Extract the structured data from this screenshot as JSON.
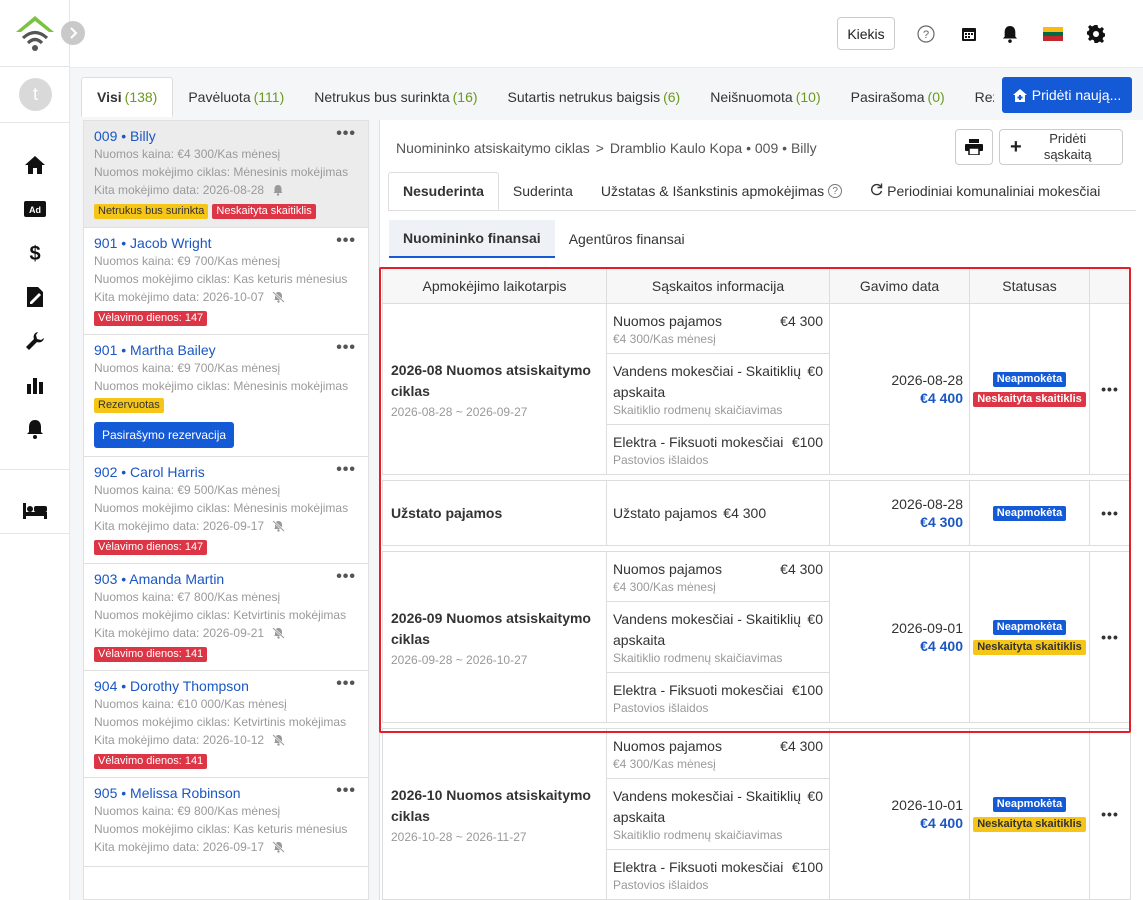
{
  "topbar": {
    "kiekis_label": "Kiekis",
    "icons": [
      "help-icon",
      "calendar-icon",
      "bell-icon",
      "flag-lt-icon",
      "gear-icon"
    ]
  },
  "rail": {
    "avatar_letter": "t",
    "icons": [
      "home-icon",
      "ad-icon",
      "dollar-icon",
      "contract-icon",
      "wrench-icon",
      "chart-icon",
      "bell-icon",
      "bed-icon"
    ]
  },
  "tabs": [
    {
      "label": "Visi",
      "count": "(138)"
    },
    {
      "label": "Pavėluota",
      "count": "(111)"
    },
    {
      "label": "Netrukus bus surinkta",
      "count": "(16)"
    },
    {
      "label": "Sutartis netrukus baigsis",
      "count": "(6)"
    },
    {
      "label": "Neišnuomota",
      "count": "(10)"
    },
    {
      "label": "Pasirašoma",
      "count": "(0)"
    },
    {
      "label": "Rezer",
      "count": ""
    }
  ],
  "add_new_label": "Pridėti naują...",
  "tenants": [
    {
      "unit": "009",
      "name": "Billy",
      "price": "Nuomos kaina: €4 300/Kas mėnesį",
      "cycle": "Nuomos mokėjimo ciklas: Mėnesinis mokėjimas",
      "next": "Kita mokėjimo data:  2026-08-28",
      "badges": [
        {
          "text": "Netrukus bus surinkta",
          "color": "yellow"
        },
        {
          "text": "Neskaityta skaitiklis",
          "color": "red"
        }
      ]
    },
    {
      "unit": "901",
      "name": "Jacob Wright",
      "price": "Nuomos kaina: €9 700/Kas mėnesį",
      "cycle": "Nuomos mokėjimo ciklas: Kas keturis mėnesius",
      "next": "Kita mokėjimo data:  2026-10-07",
      "badges": [
        {
          "text": "Vėlavimo dienos: 147",
          "color": "red"
        }
      ]
    },
    {
      "unit": "901",
      "name": "Martha Bailey",
      "price": "Nuomos kaina: €9 700/Kas mėnesį",
      "cycle": "Nuomos mokėjimo ciklas: Mėnesinis mokėjimas",
      "next": "",
      "badges": [
        {
          "text": "Rezervuotas",
          "color": "yellow"
        }
      ],
      "button": "Pasirašymo rezervacija"
    },
    {
      "unit": "902",
      "name": "Carol Harris",
      "price": "Nuomos kaina: €9 500/Kas mėnesį",
      "cycle": "Nuomos mokėjimo ciklas: Mėnesinis mokėjimas",
      "next": "Kita mokėjimo data:  2026-09-17",
      "badges": [
        {
          "text": "Vėlavimo dienos: 147",
          "color": "red"
        }
      ]
    },
    {
      "unit": "903",
      "name": "Amanda Martin",
      "price": "Nuomos kaina: €7 800/Kas mėnesį",
      "cycle": "Nuomos mokėjimo ciklas: Ketvirtinis mokėjimas",
      "next": "Kita mokėjimo data:  2026-09-21",
      "badges": [
        {
          "text": "Vėlavimo dienos: 141",
          "color": "red"
        }
      ]
    },
    {
      "unit": "904",
      "name": "Dorothy Thompson",
      "price": "Nuomos kaina: €10 000/Kas mėnesį",
      "cycle": "Nuomos mokėjimo ciklas: Ketvirtinis mokėjimas",
      "next": "Kita mokėjimo data:  2026-10-12",
      "badges": [
        {
          "text": "Vėlavimo dienos: 141",
          "color": "red"
        }
      ]
    },
    {
      "unit": "905",
      "name": "Melissa Robinson",
      "price": "Nuomos kaina: €9 800/Kas mėnesį",
      "cycle": "Nuomos mokėjimo ciklas: Kas keturis mėnesius",
      "next": "Kita mokėjimo data:  2026-09-17",
      "badges": []
    }
  ],
  "breadcrumb": {
    "part1": "Nuomininko atsiskaitymo ciklas",
    "sep": ">",
    "part2": "Dramblio Kaulo Kopa • 009 • Billy"
  },
  "add_bill_label": "Pridėti sąskaitą",
  "subtabs": [
    "Nesuderinta",
    "Suderinta",
    "Užstatas & Išankstinis apmokėjimas",
    "Periodiniai komunaliniai mokesčiai"
  ],
  "fin_tabs": [
    "Nuomininko finansai",
    "Agentūros finansai"
  ],
  "table": {
    "headers": [
      "Apmokėjimo laikotarpis",
      "Sąskaitos informacija",
      "Gavimo data",
      "Statusas",
      ""
    ],
    "rows": [
      {
        "title": "2026-08 Nuomos atsiskaitymo ciklas",
        "range": "2026-08-28 ~ 2026-09-27",
        "bills": [
          {
            "name": "Nuomos pajamos",
            "amount": "€4 300",
            "sub": "€4 300/Kas mėnesį"
          },
          {
            "name": "Vandens mokesčiai - Skaitiklių apskaita",
            "amount": "€0",
            "sub": "Skaitiklio rodmenų skaičiavimas"
          },
          {
            "name": "Elektra - Fiksuoti mokesčiai",
            "amount": "€100",
            "sub": "Pastovios išlaidos"
          }
        ],
        "date": "2026-08-28",
        "total": "€4 400",
        "statuses": [
          {
            "text": "Neapmokėta",
            "color": "blue"
          },
          {
            "text": "Neskaityta skaitiklis",
            "color": "red"
          }
        ]
      },
      {
        "title": "Užstato pajamos",
        "range": "",
        "bills": [
          {
            "name": "Užstato pajamos",
            "amount": "€4 300",
            "sub": ""
          }
        ],
        "date": "2026-08-28",
        "total": "€4 300",
        "statuses": [
          {
            "text": "Neapmokėta",
            "color": "blue"
          }
        ]
      },
      {
        "title": "2026-09 Nuomos atsiskaitymo ciklas",
        "range": "2026-09-28 ~ 2026-10-27",
        "bills": [
          {
            "name": "Nuomos pajamos",
            "amount": "€4 300",
            "sub": "€4 300/Kas mėnesį"
          },
          {
            "name": "Vandens mokesčiai - Skaitiklių apskaita",
            "amount": "€0",
            "sub": "Skaitiklio rodmenų skaičiavimas"
          },
          {
            "name": "Elektra - Fiksuoti mokesčiai",
            "amount": "€100",
            "sub": "Pastovios išlaidos"
          }
        ],
        "date": "2026-09-01",
        "total": "€4 400",
        "statuses": [
          {
            "text": "Neapmokėta",
            "color": "blue"
          },
          {
            "text": "Neskaityta skaitiklis",
            "color": "yellow"
          }
        ]
      },
      {
        "title": "2026-10 Nuomos atsiskaitymo ciklas",
        "range": "2026-10-28 ~ 2026-11-27",
        "bills": [
          {
            "name": "Nuomos pajamos",
            "amount": "€4 300",
            "sub": "€4 300/Kas mėnesį"
          },
          {
            "name": "Vandens mokesčiai - Skaitiklių apskaita",
            "amount": "€0",
            "sub": "Skaitiklio rodmenų skaičiavimas"
          },
          {
            "name": "Elektra - Fiksuoti mokesčiai",
            "amount": "€100",
            "sub": "Pastovios išlaidos"
          }
        ],
        "date": "2026-10-01",
        "total": "€4 400",
        "statuses": [
          {
            "text": "Neapmokėta",
            "color": "blue"
          },
          {
            "text": "Neskaityta skaitiklis",
            "color": "yellow"
          }
        ]
      }
    ]
  },
  "colors": {
    "accent": "#1459d6",
    "link": "#1a56c4",
    "red": "#dc3545",
    "yellow": "#f5c518",
    "count_green": "#6a9a1f",
    "highlight_border": "#e0202a"
  }
}
